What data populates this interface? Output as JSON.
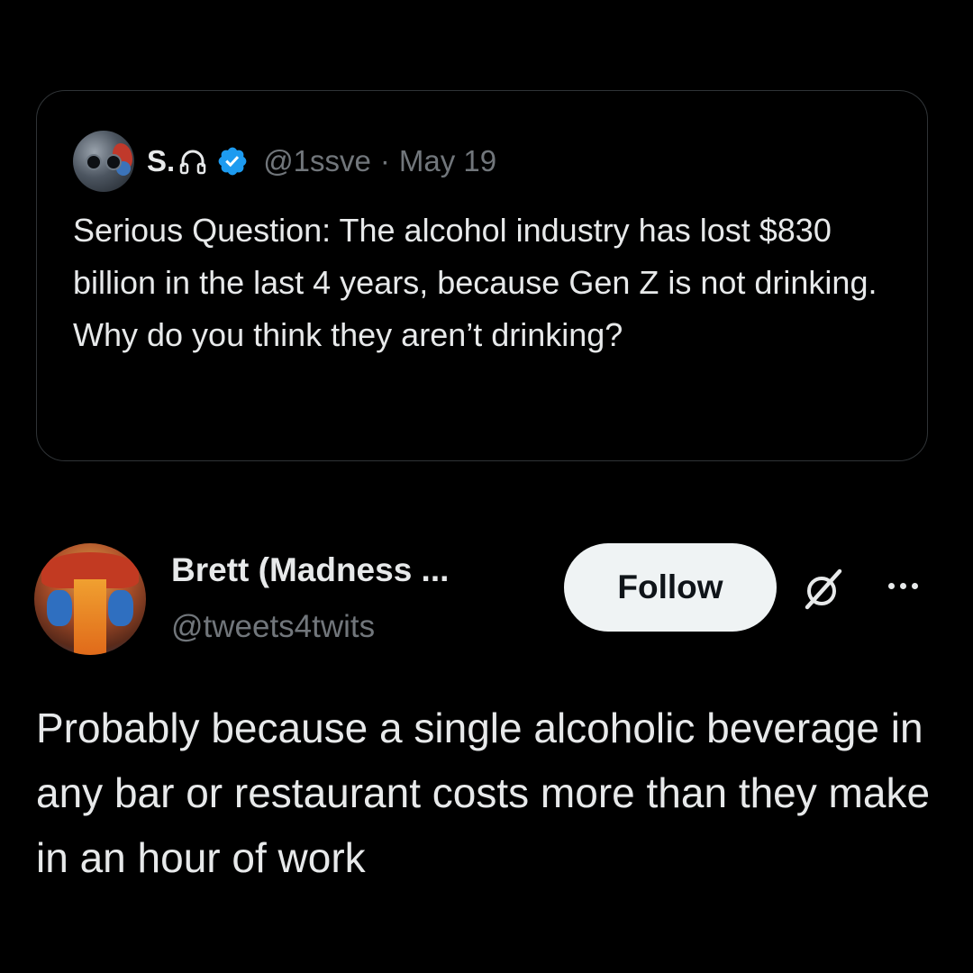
{
  "quoted_tweet": {
    "author_name": "S.",
    "author_handle": "@1ssve",
    "separator": "·",
    "date": "May 19",
    "verified": true,
    "text": "Serious Question: The alcohol industry has lost $830 billion in the last 4 years, because Gen Z is not drinking. Why do you think they aren’t drinking?",
    "icons": [
      "headphones-icon",
      "verified-badge-icon"
    ]
  },
  "reply": {
    "author_name": "Brett (Madness ...",
    "author_handle": "@tweets4twits",
    "follow_label": "Follow",
    "text": "Probably because a single alcoholic beverage in any bar or restaurant costs more than they make in an hour of work",
    "icons": [
      "grok-icon",
      "more-options-icon"
    ]
  },
  "colors": {
    "background": "#000000",
    "primary_text": "#e7e9ea",
    "secondary_text": "#71767b",
    "card_border": "#2f3336",
    "verified_blue": "#1d9bf0",
    "follow_button_bg": "#eff3f4",
    "follow_button_text": "#0f1419"
  }
}
